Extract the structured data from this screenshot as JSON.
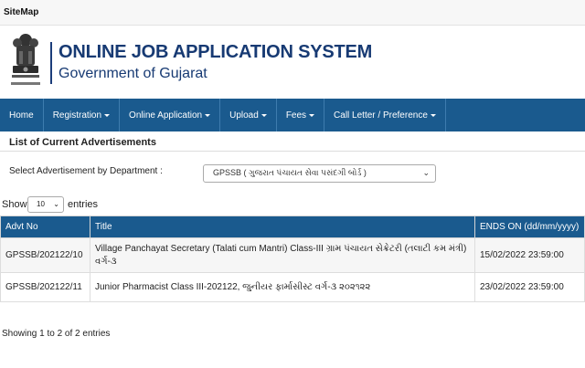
{
  "topbar": {
    "sitemap": "SiteMap"
  },
  "header": {
    "title": "ONLINE JOB APPLICATION SYSTEM",
    "subtitle": "Government of Gujarat"
  },
  "nav": [
    {
      "label": "Home",
      "dropdown": false
    },
    {
      "label": "Registration",
      "dropdown": true
    },
    {
      "label": "Online Application",
      "dropdown": true
    },
    {
      "label": "Upload",
      "dropdown": true
    },
    {
      "label": "Fees",
      "dropdown": true
    },
    {
      "label": "Call Letter / Preference",
      "dropdown": true
    }
  ],
  "section_title": "List of Current Advertisements",
  "filter": {
    "label": "Select Advertisement by Department :",
    "selected": "GPSSB ( ગુજરાત પંચાયત સેવા પસંદગી બોર્ડ )"
  },
  "length": {
    "show": "Show",
    "value": "10",
    "entries": "entries"
  },
  "table": {
    "headers": [
      "Advt No",
      "Title",
      "ENDS ON (dd/mm/yyyy)"
    ],
    "rows": [
      {
        "advt": "GPSSB/202122/10",
        "title": "Village Panchayat Secretary (Talati cum Mantri) Class-III ગ્રામ પંચાયત સેક્રેટરી (તલાટી કમ મંત્રી) વર્ગ-૩",
        "ends": "15/02/2022 23:59:00"
      },
      {
        "advt": "GPSSB/202122/11",
        "title": "Junior Pharmacist Class III-202122, જુનીયર ફાર્માસીસ્ટ વર્ગ-૩ ૨૦૨૧૨૨",
        "ends": "23/02/2022 23:59:00"
      }
    ]
  },
  "info": "Showing 1 to 2 of 2 entries",
  "colors": {
    "primary": "#1a5a8e",
    "title": "#173a73"
  }
}
